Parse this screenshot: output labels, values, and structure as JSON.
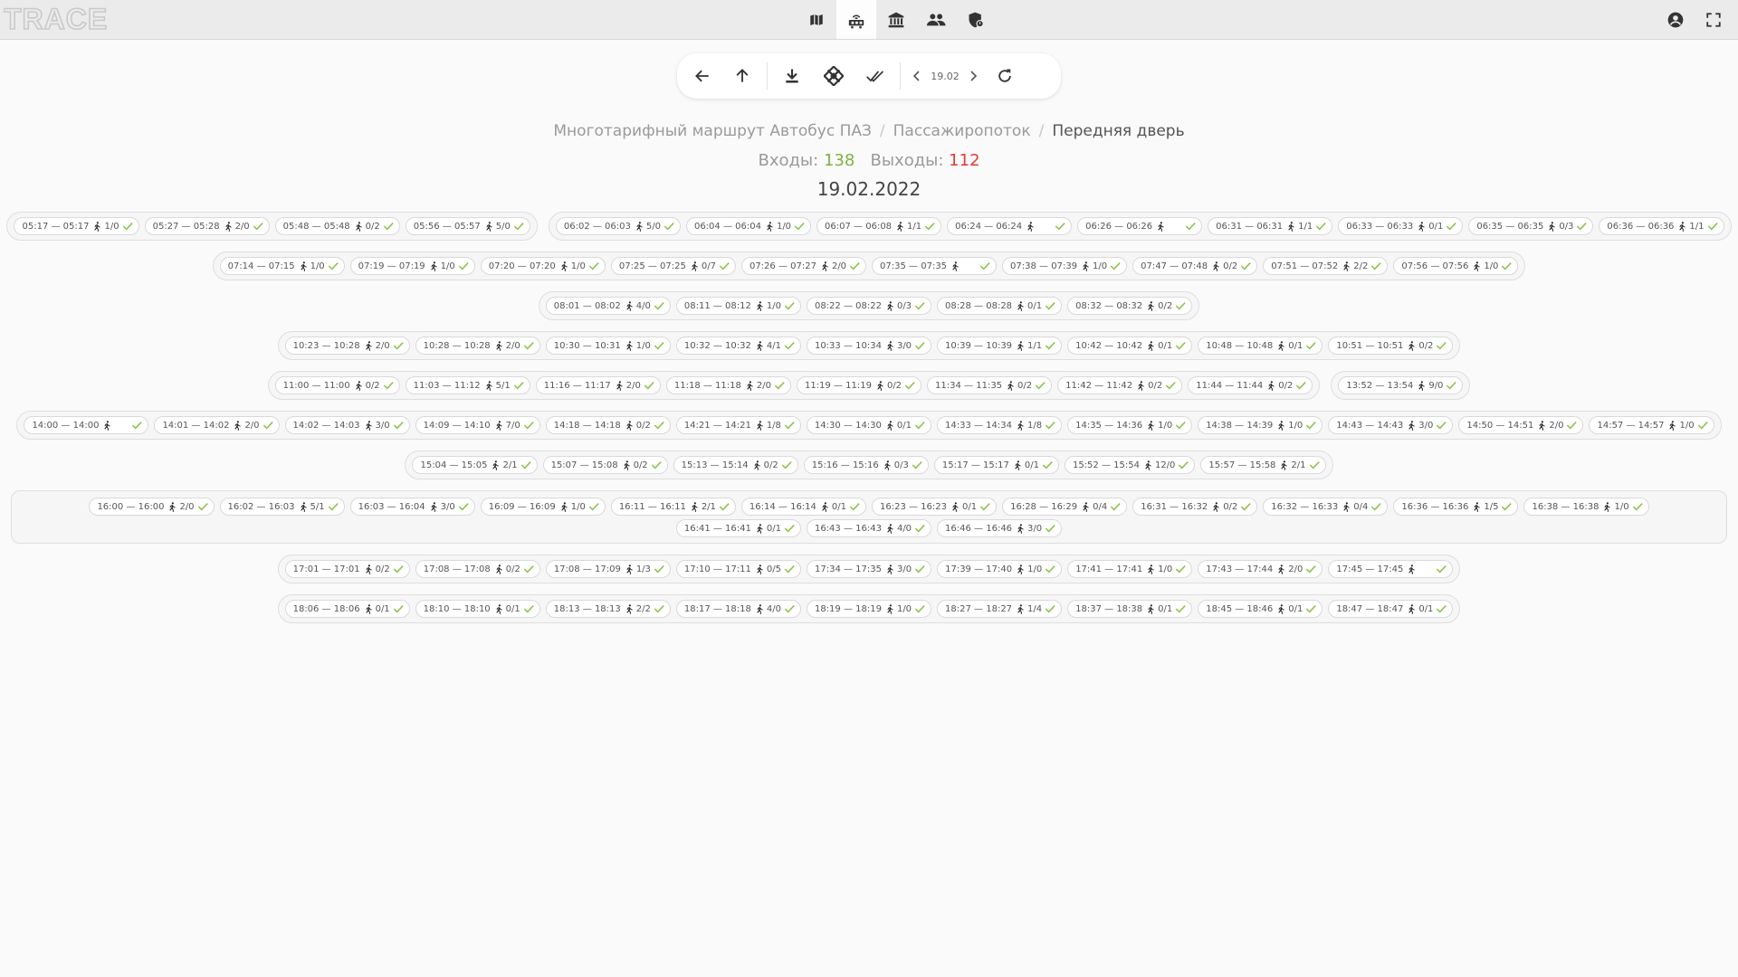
{
  "app": {
    "logo_text": "TRACE"
  },
  "nav": {
    "items": [
      {
        "icon": "map-icon",
        "active": false
      },
      {
        "icon": "transport-icon",
        "active": true
      },
      {
        "icon": "institution-icon",
        "active": false
      },
      {
        "icon": "users-icon",
        "active": false
      },
      {
        "icon": "security-shield-icon",
        "active": false
      }
    ],
    "right_icons": [
      "account-icon",
      "fullscreen-icon"
    ]
  },
  "toolbar": {
    "buttons": [
      "back-arrow-icon",
      "up-arrow-icon",
      "download-icon",
      "merge-icon",
      "check-all-icon"
    ],
    "date": "19.02",
    "refresh": "refresh-icon"
  },
  "breadcrumb": {
    "route": "Многотарифный маршрут Автобус ПАЗ",
    "section": "Пассажиропоток",
    "current": "Передняя дверь"
  },
  "stats": {
    "in_label": "Входы:",
    "in_value": "138",
    "out_label": "Выходы:",
    "out_value": "112"
  },
  "date_title": "19.02.2022",
  "colors": {
    "accent_green": "#7cb342",
    "accent_red": "#e53935",
    "check_green": "#8bc34a"
  },
  "rows": [
    {
      "groups": [
        [
          [
            "05:17 — 05:17",
            "1/0"
          ],
          [
            "05:27 — 05:28",
            "2/0"
          ],
          [
            "05:48 — 05:48",
            "0/2"
          ],
          [
            "05:56 — 05:57",
            "5/0"
          ]
        ],
        [
          [
            "06:02 — 06:03",
            "5/0"
          ],
          [
            "06:04 — 06:04",
            "1/0"
          ],
          [
            "06:07 — 06:08",
            "1/1"
          ],
          [
            "06:24 — 06:24",
            ""
          ],
          [
            "06:26 — 06:26",
            ""
          ],
          [
            "06:31 — 06:31",
            "1/1"
          ],
          [
            "06:33 — 06:33",
            "0/1"
          ],
          [
            "06:35 — 06:35",
            "0/3"
          ],
          [
            "06:36 — 06:36",
            "1/1"
          ]
        ]
      ]
    },
    {
      "groups": [
        [
          [
            "07:14 — 07:15",
            "1/0"
          ],
          [
            "07:19 — 07:19",
            "1/0"
          ],
          [
            "07:20 — 07:20",
            "1/0"
          ],
          [
            "07:25 — 07:25",
            "0/7"
          ],
          [
            "07:26 — 07:27",
            "2/0"
          ],
          [
            "07:35 — 07:35",
            ""
          ],
          [
            "07:38 — 07:39",
            "1/0"
          ],
          [
            "07:47 — 07:48",
            "0/2"
          ],
          [
            "07:51 — 07:52",
            "2/2"
          ],
          [
            "07:56 — 07:56",
            "1/0"
          ]
        ]
      ]
    },
    {
      "groups": [
        [
          [
            "08:01 — 08:02",
            "4/0"
          ],
          [
            "08:11 — 08:12",
            "1/0"
          ],
          [
            "08:22 — 08:22",
            "0/3"
          ],
          [
            "08:28 — 08:28",
            "0/1"
          ],
          [
            "08:32 — 08:32",
            "0/2"
          ]
        ]
      ]
    },
    {
      "groups": [
        [
          [
            "10:23 — 10:28",
            "2/0"
          ],
          [
            "10:28 — 10:28",
            "2/0"
          ],
          [
            "10:30 — 10:31",
            "1/0"
          ],
          [
            "10:32 — 10:32",
            "4/1"
          ],
          [
            "10:33 — 10:34",
            "3/0"
          ],
          [
            "10:39 — 10:39",
            "1/1"
          ],
          [
            "10:42 — 10:42",
            "0/1"
          ],
          [
            "10:48 — 10:48",
            "0/1"
          ],
          [
            "10:51 — 10:51",
            "0/2"
          ]
        ]
      ]
    },
    {
      "groups": [
        [
          [
            "11:00 — 11:00",
            "0/2"
          ],
          [
            "11:03 — 11:12",
            "5/1"
          ],
          [
            "11:16 — 11:17",
            "2/0"
          ],
          [
            "11:18 — 11:18",
            "2/0"
          ],
          [
            "11:19 — 11:19",
            "0/2"
          ],
          [
            "11:34 — 11:35",
            "0/2"
          ],
          [
            "11:42 — 11:42",
            "0/2"
          ],
          [
            "11:44 — 11:44",
            "0/2"
          ]
        ],
        [
          [
            "13:52 — 13:54",
            "9/0"
          ]
        ]
      ]
    },
    {
      "groups": [
        [
          [
            "14:00 — 14:00",
            ""
          ],
          [
            "14:01 — 14:02",
            "2/0"
          ],
          [
            "14:02 — 14:03",
            "3/0"
          ],
          [
            "14:09 — 14:10",
            "7/0"
          ],
          [
            "14:18 — 14:18",
            "0/2"
          ],
          [
            "14:21 — 14:21",
            "1/8"
          ],
          [
            "14:30 — 14:30",
            "0/1"
          ],
          [
            "14:33 — 14:34",
            "1/8"
          ],
          [
            "14:35 — 14:36",
            "1/0"
          ],
          [
            "14:38 — 14:39",
            "1/0"
          ],
          [
            "14:43 — 14:43",
            "3/0"
          ],
          [
            "14:50 — 14:51",
            "2/0"
          ],
          [
            "14:57 — 14:57",
            "1/0"
          ]
        ]
      ]
    },
    {
      "groups": [
        [
          [
            "15:04 — 15:05",
            "2/1"
          ],
          [
            "15:07 — 15:08",
            "0/2"
          ],
          [
            "15:13 — 15:14",
            "0/2"
          ],
          [
            "15:16 — 15:16",
            "0/3"
          ],
          [
            "15:17 — 15:17",
            "0/1"
          ],
          [
            "15:52 — 15:54",
            "12/0"
          ],
          [
            "15:57 — 15:58",
            "2/1"
          ]
        ]
      ]
    },
    {
      "wide": true,
      "groups": [
        [
          [
            "16:00 — 16:00",
            "2/0"
          ],
          [
            "16:02 — 16:03",
            "5/1"
          ],
          [
            "16:03 — 16:04",
            "3/0"
          ],
          [
            "16:09 — 16:09",
            "1/0"
          ],
          [
            "16:11 — 16:11",
            "2/1"
          ],
          [
            "16:14 — 16:14",
            "0/1"
          ],
          [
            "16:23 — 16:23",
            "0/1"
          ],
          [
            "16:28 — 16:29",
            "0/4"
          ],
          [
            "16:31 — 16:32",
            "0/2"
          ],
          [
            "16:32 — 16:33",
            "0/4"
          ],
          [
            "16:36 — 16:36",
            "1/5"
          ],
          [
            "16:38 — 16:38",
            "1/0"
          ],
          [
            "16:41 — 16:41",
            "0/1"
          ],
          [
            "16:43 — 16:43",
            "4/0"
          ],
          [
            "16:46 — 16:46",
            "3/0"
          ]
        ]
      ]
    },
    {
      "groups": [
        [
          [
            "17:01 — 17:01",
            "0/2"
          ],
          [
            "17:08 — 17:08",
            "0/2"
          ],
          [
            "17:08 — 17:09",
            "1/3"
          ],
          [
            "17:10 — 17:11",
            "0/5"
          ],
          [
            "17:34 — 17:35",
            "3/0"
          ],
          [
            "17:39 — 17:40",
            "1/0"
          ],
          [
            "17:41 — 17:41",
            "1/0"
          ],
          [
            "17:43 — 17:44",
            "2/0"
          ],
          [
            "17:45 — 17:45",
            ""
          ]
        ]
      ]
    },
    {
      "groups": [
        [
          [
            "18:06 — 18:06",
            "0/1"
          ],
          [
            "18:10 — 18:10",
            "0/1"
          ],
          [
            "18:13 — 18:13",
            "2/2"
          ],
          [
            "18:17 — 18:18",
            "4/0"
          ],
          [
            "18:19 — 18:19",
            "1/0"
          ],
          [
            "18:27 — 18:27",
            "1/4"
          ],
          [
            "18:37 — 18:38",
            "0/1"
          ],
          [
            "18:45 — 18:46",
            "0/1"
          ],
          [
            "18:47 — 18:47",
            "0/1"
          ]
        ]
      ]
    }
  ]
}
